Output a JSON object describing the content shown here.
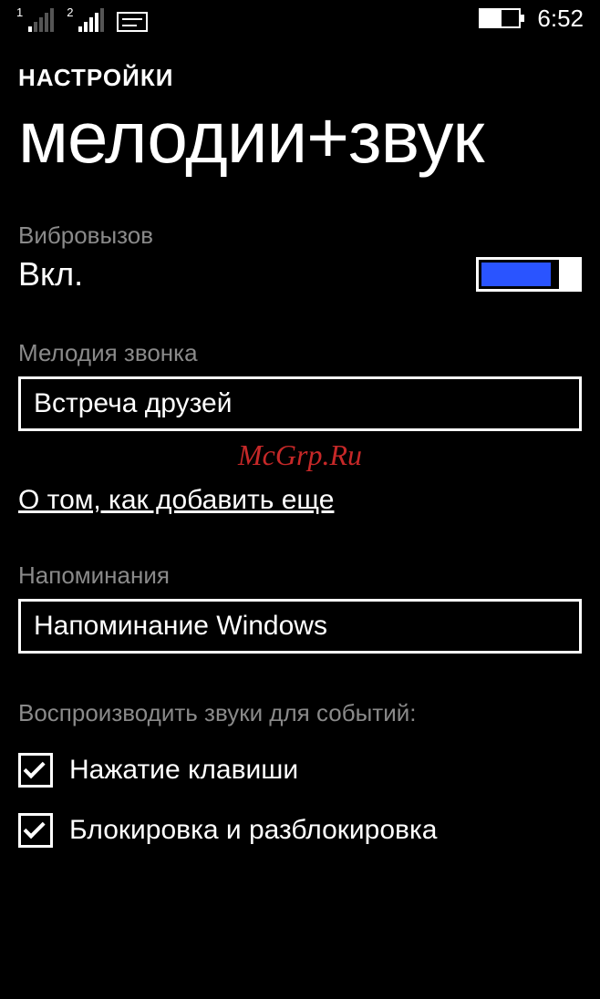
{
  "status": {
    "sim1": "1",
    "sim2": "2",
    "clock": "6:52"
  },
  "breadcrumb": "НАСТРОЙКИ",
  "title": "мелодии+звук",
  "vibrate": {
    "label": "Вибровызов",
    "value": "Вкл.",
    "on": true
  },
  "ringtone": {
    "label": "Мелодия звонка",
    "value": "Встреча друзей"
  },
  "watermark": "McGrp.Ru",
  "add_more_link": "О том, как добавить еще",
  "reminders": {
    "label": "Напоминания",
    "value": "Напоминание Windows"
  },
  "events": {
    "label": "Воспроизводить звуки для событий:",
    "items": [
      {
        "label": "Нажатие клавиши",
        "checked": true
      },
      {
        "label": "Блокировка и разблокировка",
        "checked": true
      }
    ]
  }
}
